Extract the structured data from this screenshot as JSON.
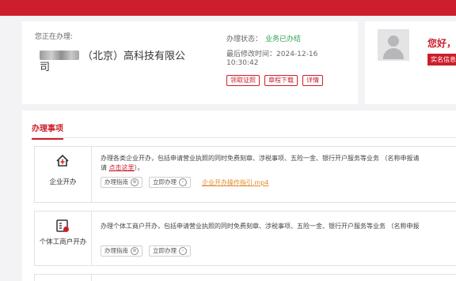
{
  "status_card": {
    "doing_label": "您正在办理:",
    "company_name": "（北京）高科技有限公司",
    "status_label": "办理状态：",
    "status_value": "业务已办结",
    "modified_label": "最后修改时间：",
    "modified_value": "2024-12-16 10:30:42",
    "buttons": [
      "领取证照",
      "章程下载",
      "详情"
    ]
  },
  "user_card": {
    "greeting": "您好，",
    "realname_label": "实名信息"
  },
  "main": {
    "tab_label": "办理事项",
    "items": [
      {
        "title": "企业开办",
        "icon": "house-icon",
        "description": "办理各类企业开办，包括申请营业执照的同时免费刻章、涉税事项、五险一金、银行开户服务等业务 （名称申报请",
        "description_line2_prefix": "请 ",
        "link_text": "点击这里",
        "description_line2_suffix": "）。",
        "guide_label": "办理指南",
        "apply_label": "立即办理",
        "video_label": "企业开办操作指引.mp4"
      },
      {
        "title": "个体工商户开办",
        "icon": "id-card-icon",
        "description": "办理个体工商户开办，包括申请营业执照的同时免费刻章、涉税事项、五险一金、银行开户服务等业务 （名称申报",
        "guide_label": "办理指南",
        "apply_label": "立即办理"
      }
    ]
  },
  "colors": {
    "accent": "#cc1f2b",
    "success": "#2ea44f",
    "video_link": "#e0892a",
    "background": "#f3f3f5"
  }
}
